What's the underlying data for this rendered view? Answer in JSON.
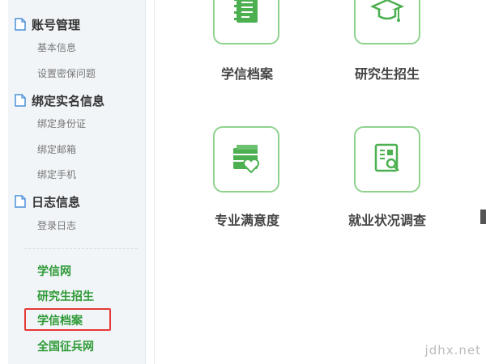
{
  "sidebar": {
    "sections": [
      {
        "title": "账号管理",
        "items": [
          "基本信息",
          "设置密保问题"
        ]
      },
      {
        "title": "绑定实名信息",
        "items": [
          "绑定身份证",
          "绑定邮箱",
          "绑定手机"
        ]
      },
      {
        "title": "日志信息",
        "items": [
          "登录日志"
        ]
      }
    ],
    "links": [
      "学信网",
      "研究生招生",
      "学信档案",
      "全国征兵网"
    ],
    "highlighted_link": "学信档案"
  },
  "main": {
    "tiles": [
      {
        "label": "学信档案",
        "icon": "notebook-icon"
      },
      {
        "label": "研究生招生",
        "icon": "graduation-cap-icon"
      },
      {
        "label": "专业满意度",
        "icon": "heart-folder-icon"
      },
      {
        "label": "就业状况调查",
        "icon": "report-search-icon"
      }
    ]
  },
  "watermark": "jdhx.net",
  "colors": {
    "accent_green": "#2f9a36",
    "tile_border": "#8fd28e",
    "highlight_red": "#e53935",
    "sidebar_bg": "#f1f5f8"
  }
}
